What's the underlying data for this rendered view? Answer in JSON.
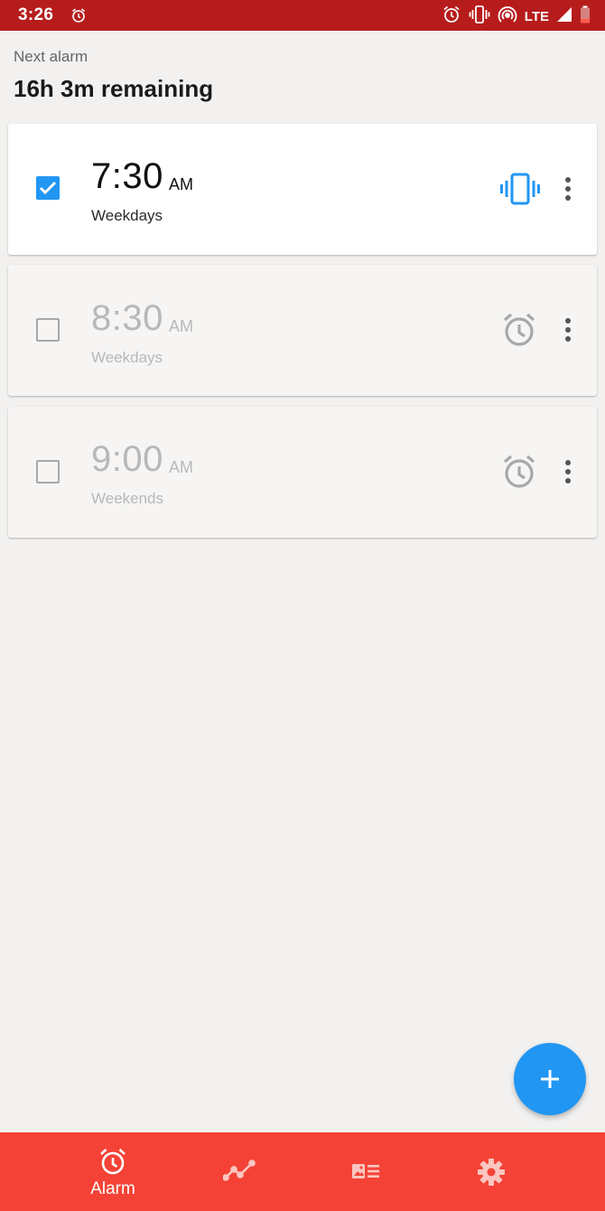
{
  "status_bar": {
    "time": "3:26",
    "network": "LTE",
    "icons": [
      "alarm-icon",
      "vibrate-icon",
      "hotspot-icon",
      "signal-icon",
      "battery-icon"
    ]
  },
  "header": {
    "next_alarm_label": "Next alarm",
    "remaining": "16h 3m remaining"
  },
  "alarms": [
    {
      "time": "7:30",
      "ampm": "AM",
      "days": "Weekdays",
      "enabled": true,
      "sound_icon": "vibrate-icon"
    },
    {
      "time": "8:30",
      "ampm": "AM",
      "days": "Weekdays",
      "enabled": false,
      "sound_icon": "alarm-clock-icon"
    },
    {
      "time": "9:00",
      "ampm": "AM",
      "days": "Weekends",
      "enabled": false,
      "sound_icon": "alarm-clock-icon"
    }
  ],
  "fab": {
    "icon": "plus-icon"
  },
  "bottom_nav": {
    "items": [
      {
        "label": "Alarm",
        "icon": "alarm-clock-icon",
        "active": true
      },
      {
        "label": "",
        "icon": "trend-chart-icon",
        "active": false
      },
      {
        "label": "",
        "icon": "news-card-icon",
        "active": false
      },
      {
        "label": "",
        "icon": "gear-icon",
        "active": false
      }
    ]
  },
  "colors": {
    "status_bar": "#b71c1c",
    "accent": "#2196f3",
    "nav_bar": "#f44336",
    "background": "#f2f1f0"
  }
}
